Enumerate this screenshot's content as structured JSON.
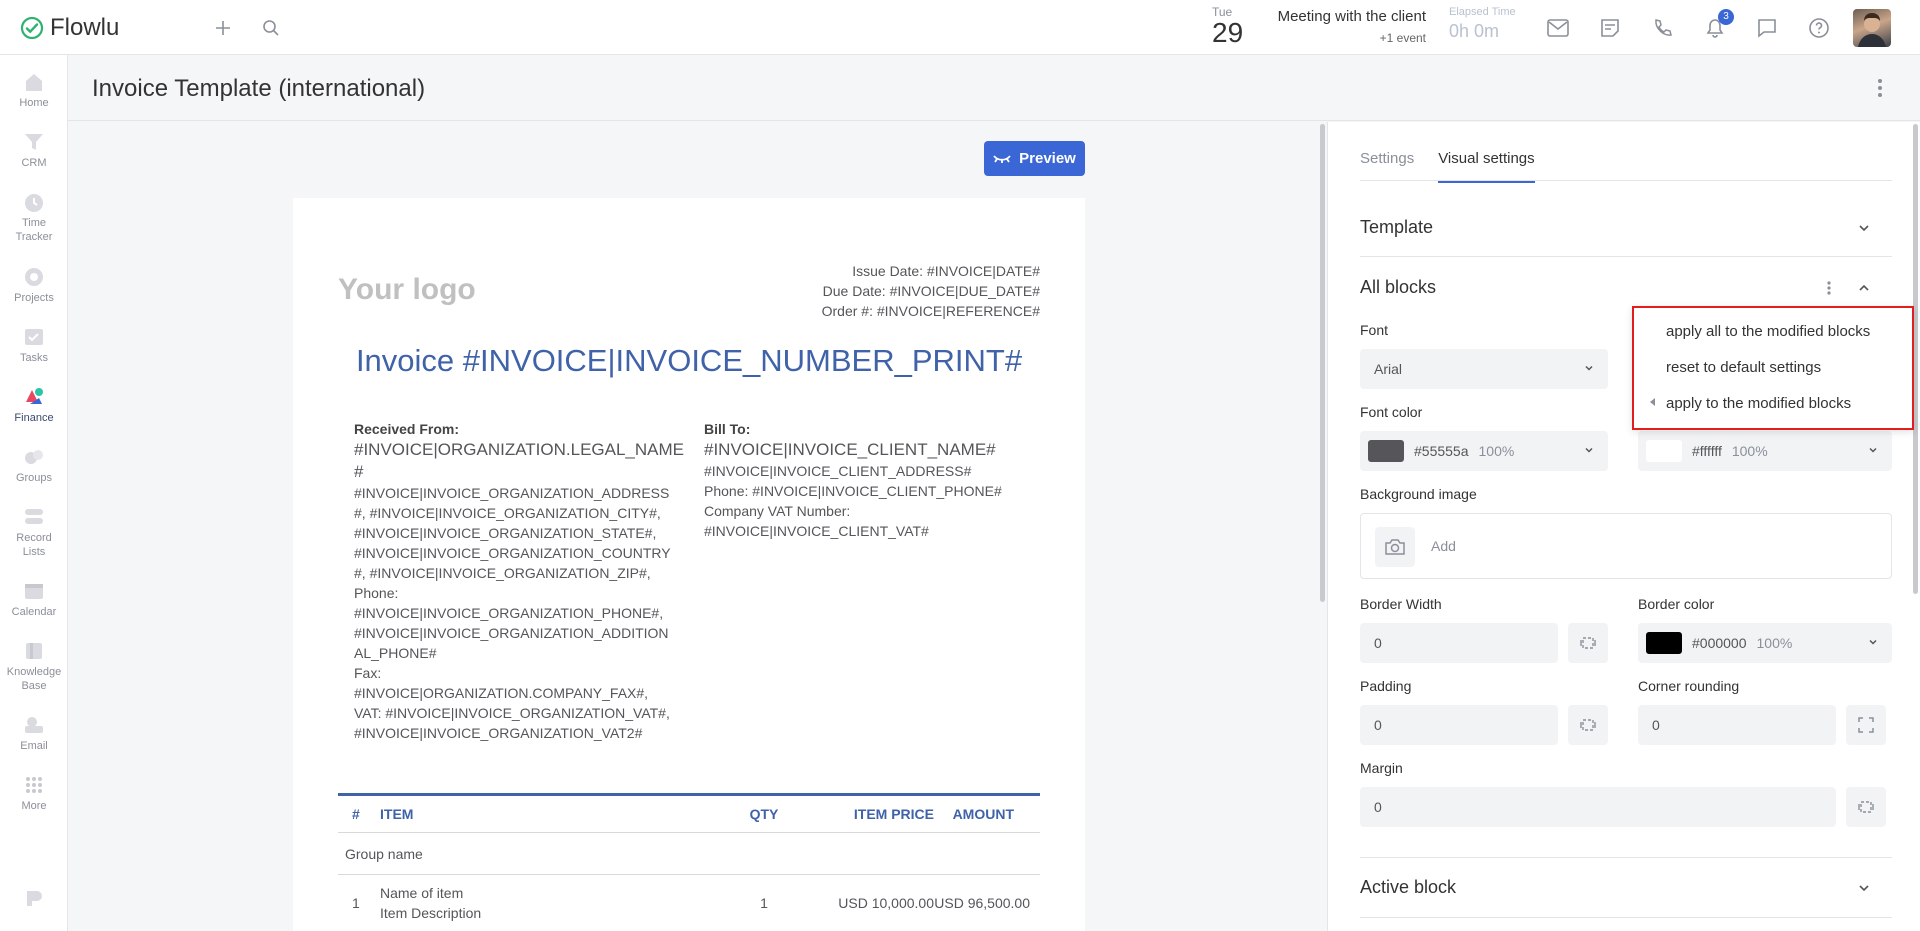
{
  "app": {
    "name": "Flowlu"
  },
  "topbar": {
    "date": {
      "dow": "Tue",
      "day": "29"
    },
    "event": {
      "title": "Meeting with the client",
      "more": "+1 event"
    },
    "elapsed": {
      "label": "Elapsed Time",
      "value": "0h 0m"
    },
    "notifications_count": "3"
  },
  "sidebar": {
    "items": [
      {
        "label1": "Home",
        "label2": ""
      },
      {
        "label1": "CRM",
        "label2": ""
      },
      {
        "label1": "Time",
        "label2": "Tracker"
      },
      {
        "label1": "Projects",
        "label2": ""
      },
      {
        "label1": "Tasks",
        "label2": ""
      },
      {
        "label1": "Finance",
        "label2": ""
      },
      {
        "label1": "Groups",
        "label2": ""
      },
      {
        "label1": "Record",
        "label2": "Lists"
      },
      {
        "label1": "Calendar",
        "label2": ""
      },
      {
        "label1": "Knowledge",
        "label2": "Base"
      },
      {
        "label1": "Email",
        "label2": ""
      },
      {
        "label1": "More",
        "label2": ""
      }
    ]
  },
  "page": {
    "title": "Invoice Template (international)"
  },
  "editor": {
    "preview_label": "Preview",
    "doc": {
      "logo": "Your logo",
      "meta": [
        "Issue Date: #INVOICE|DATE#",
        "Due Date: #INVOICE|DUE_DATE#",
        "Order #: #INVOICE|REFERENCE#"
      ],
      "title": "Invoice #INVOICE|INVOICE_NUMBER_PRINT#",
      "from": {
        "header": "Received From:",
        "big": [
          "#INVOICE|ORGANIZATION.LEGAL_NAME",
          "#"
        ],
        "lines": [
          "#INVOICE|INVOICE_ORGANIZATION_ADDRESS",
          "#, #INVOICE|INVOICE_ORGANIZATION_CITY#,",
          "#INVOICE|INVOICE_ORGANIZATION_STATE#,",
          "#INVOICE|INVOICE_ORGANIZATION_COUNTRY",
          "#, #INVOICE|INVOICE_ORGANIZATION_ZIP#,",
          "Phone:",
          "#INVOICE|INVOICE_ORGANIZATION_PHONE#,",
          "#INVOICE|INVOICE_ORGANIZATION_ADDITION",
          "AL_PHONE#",
          "Fax:",
          "#INVOICE|ORGANIZATION.COMPANY_FAX#,",
          "VAT: #INVOICE|INVOICE_ORGANIZATION_VAT#,",
          "#INVOICE|INVOICE_ORGANIZATION_VAT2#"
        ]
      },
      "to": {
        "header": "Bill To:",
        "big": [
          "#INVOICE|INVOICE_CLIENT_NAME#"
        ],
        "lines": [
          "#INVOICE|INVOICE_CLIENT_ADDRESS#",
          "Phone: #INVOICE|INVOICE_CLIENT_PHONE#",
          "Company VAT Number:",
          "#INVOICE|INVOICE_CLIENT_VAT#"
        ]
      },
      "table": {
        "headers": [
          "#",
          "ITEM",
          "QTY",
          "ITEM PRICE",
          "AMOUNT"
        ],
        "group": "Group name",
        "row": {
          "num": "1",
          "name": "Name of item",
          "desc": "Item Description",
          "qty": "1",
          "price": "USD 10,000.00",
          "amount": "USD 96,500.00"
        }
      }
    }
  },
  "panel": {
    "tabs": [
      "Settings",
      "Visual settings"
    ],
    "template_label": "Template",
    "all_blocks_label": "All blocks",
    "font_label": "Font",
    "font_value": "Arial",
    "font_color_label": "Font color",
    "font_color": {
      "hex": "#55555a",
      "pct": "100%"
    },
    "bg_color": {
      "hex": "#ffffff",
      "pct": "100%"
    },
    "bg_image_label": "Background image",
    "add_label": "Add",
    "border_width_label": "Border Width",
    "border_width_value": "0",
    "border_color_label": "Border color",
    "border_color": {
      "hex": "#000000",
      "pct": "100%"
    },
    "padding_label": "Padding",
    "padding_value": "0",
    "corner_label": "Corner rounding",
    "corner_value": "0",
    "margin_label": "Margin",
    "margin_value": "0",
    "active_block_label": "Active block"
  },
  "menu": {
    "items": [
      "apply all to the modified blocks",
      "reset to default settings",
      "apply to the modified blocks"
    ]
  }
}
